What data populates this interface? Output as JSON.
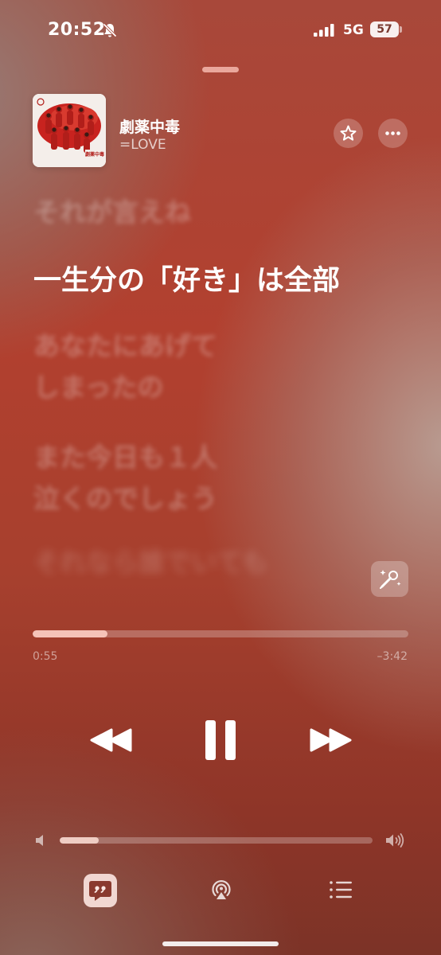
{
  "status_bar": {
    "time": "20:52",
    "network": "5G",
    "battery": "57",
    "icons": [
      "bell-slash-icon",
      "signal-icon",
      "battery-icon"
    ]
  },
  "now_playing": {
    "title": "劇薬中毒",
    "artist": "=LOVE",
    "artwork_text": "劇薬中毒"
  },
  "lyrics": {
    "lines": [
      "それが言えね",
      "一生分の「好き」は全部",
      "あなたにあげて",
      "しまったの",
      "また今日も１人",
      "泣くのでしょう",
      "それなら誰でいても"
    ],
    "active_index": 1
  },
  "playback": {
    "elapsed": "0:55",
    "remaining": "–3:42",
    "progress_fraction": 0.2
  },
  "volume": {
    "level_fraction": 0.125
  },
  "colors": {
    "accent_fill": "#ffd2c8",
    "background_red": "#a8402f"
  },
  "icons": {
    "favorite": "star-icon",
    "more": "ellipsis-icon",
    "sing": "microphone-sparkle-icon",
    "rewind": "backward-icon",
    "pause": "pause-icon",
    "forward": "forward-icon",
    "lyrics": "quote-bubble-icon",
    "airplay": "airplay-audio-icon",
    "queue": "list-icon"
  }
}
